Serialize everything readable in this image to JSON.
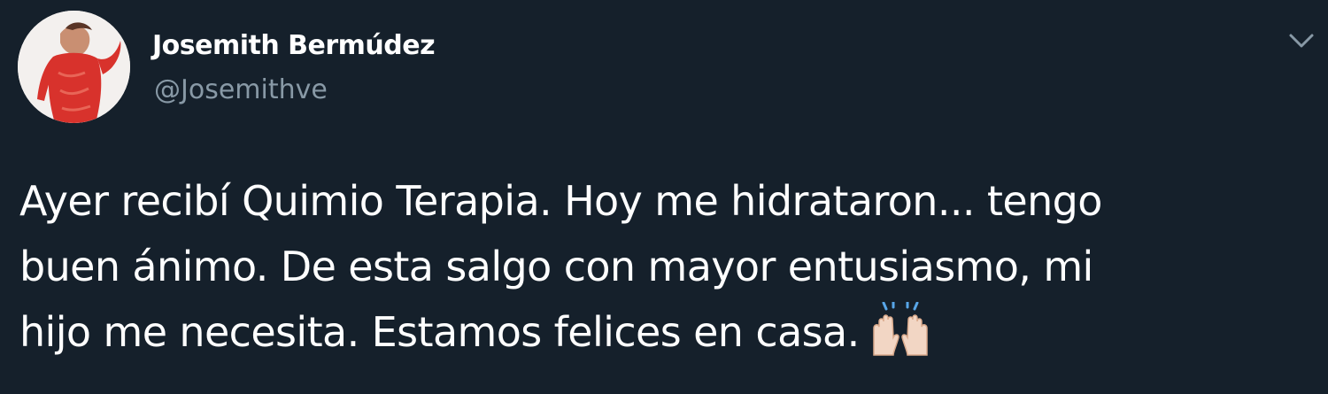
{
  "author": {
    "display_name": "Josemith Bermúdez",
    "handle": "@Josemithve"
  },
  "tweet": {
    "text": "Ayer recibí Quimio Terapia. Hoy me hidrataron... tengo\nbuen ánimo. De esta salgo con mayor entusiasmo, mi\nhijo me necesita. Estamos felices en casa.",
    "emoji": "raising-hands-emoji"
  },
  "icons": {
    "menu": "chevron-down-icon"
  },
  "colors": {
    "background": "#15202b",
    "primary_text": "#ffffff",
    "secondary_text": "#8899a6"
  }
}
